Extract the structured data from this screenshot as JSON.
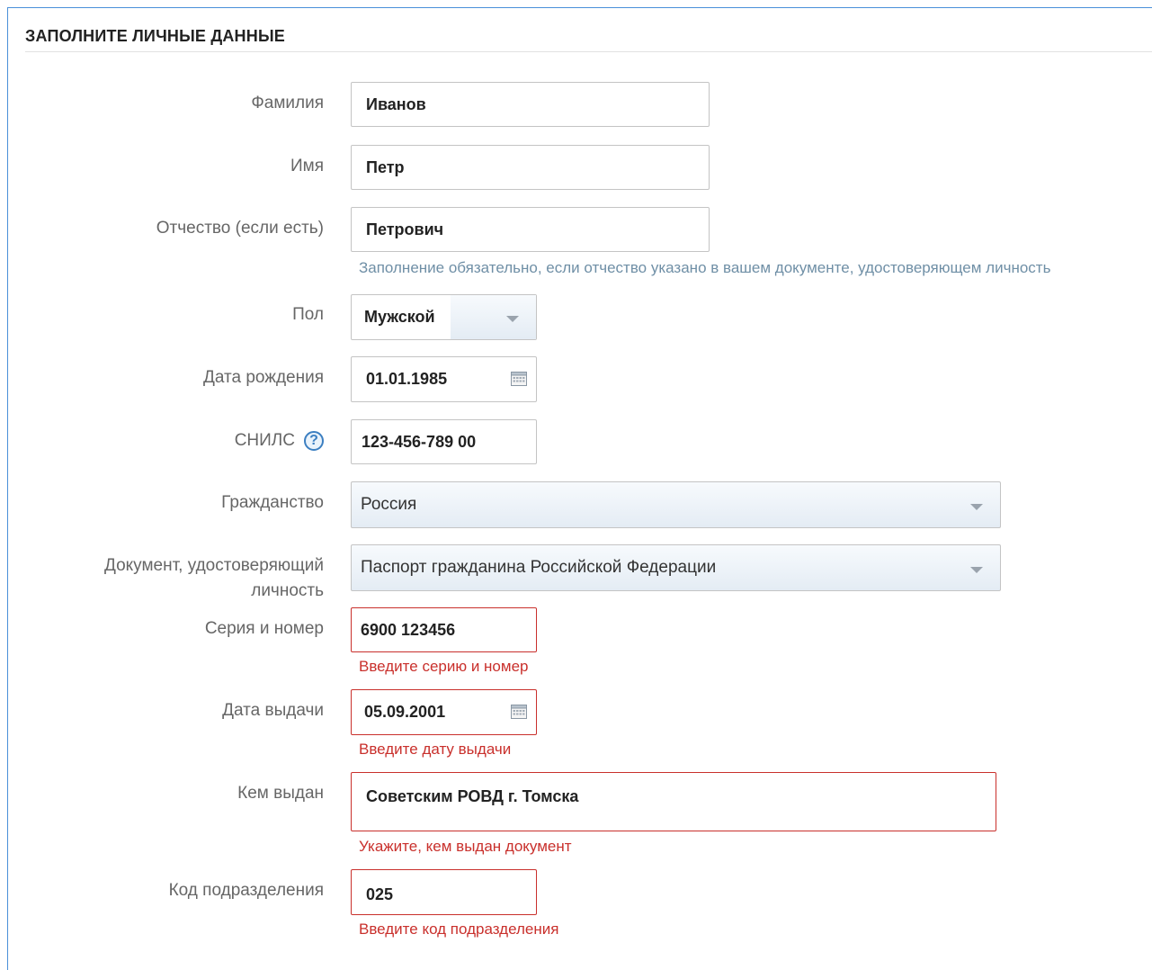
{
  "form": {
    "title": "ЗАПОЛНИТЕ ЛИЧНЫЕ ДАННЫЕ",
    "surname": {
      "label": "Фамилия",
      "value": "Иванов"
    },
    "name": {
      "label": "Имя",
      "value": "Петр"
    },
    "patronymic": {
      "label": "Отчество (если есть)",
      "value": "Петрович",
      "hint": "Заполнение обязательно, если отчество указано в вашем документе, удостоверяющем личность"
    },
    "gender": {
      "label": "Пол",
      "value": "Мужской"
    },
    "birth_date": {
      "label": "Дата рождения",
      "value": "01.01.1985"
    },
    "snils": {
      "label": "СНИЛС",
      "value": "123-456-789 00",
      "help_symbol": "?"
    },
    "citizenship": {
      "label": "Гражданство",
      "value": "Россия"
    },
    "id_document": {
      "label_line1": "Документ, удостоверяющий",
      "label_line2": "личность",
      "value": "Паспорт гражданина Российской Федерации"
    },
    "series_number": {
      "label": "Серия и номер",
      "value": "6900 123456",
      "error": "Введите серию и номер"
    },
    "issue_date": {
      "label": "Дата выдачи",
      "value": "05.09.2001",
      "error": "Введите дату выдачи"
    },
    "issued_by": {
      "label": "Кем выдан",
      "value": "Советским РОВД г. Томска",
      "error": "Укажите, кем выдан документ"
    },
    "division_code": {
      "label": "Код подразделения",
      "value": "025",
      "error": "Введите код подразделения"
    }
  },
  "colors": {
    "frame_border": "#4a90d9",
    "error": "#c9302c",
    "hint": "#6f8fa6",
    "help_icon": "#3c7fc1"
  }
}
